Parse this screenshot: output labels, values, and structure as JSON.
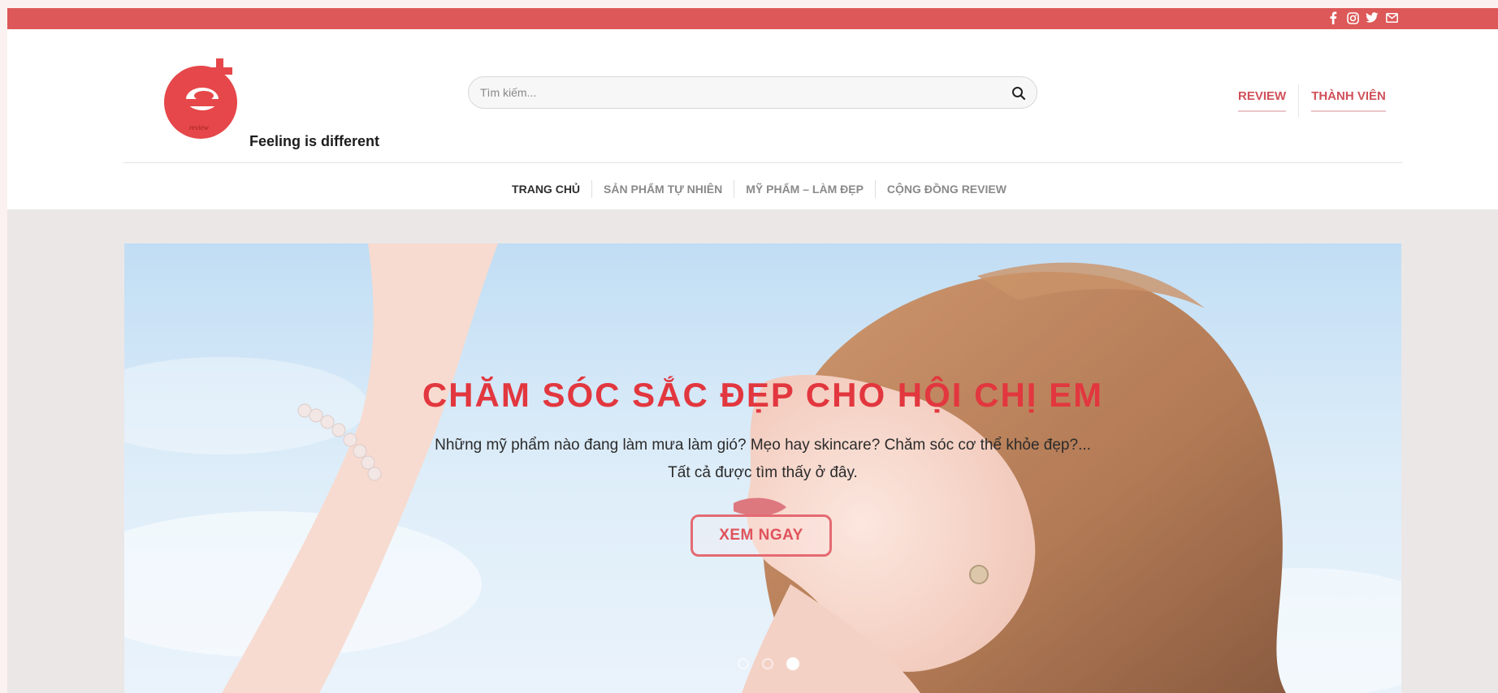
{
  "topbar": {
    "color": "#dd5858",
    "social": [
      "facebook-icon",
      "instagram-icon",
      "twitter-icon",
      "envelope-icon"
    ]
  },
  "header": {
    "logo_tagline": "Feeling is different",
    "logo_small_text": "review",
    "search": {
      "placeholder": "Tìm kiếm..."
    },
    "account_links": [
      "REVIEW",
      "THÀNH VIÊN"
    ]
  },
  "nav": {
    "items": [
      "TRANG CHỦ",
      "SẢN PHẨM TỰ NHIÊN",
      "MỸ PHẨM – LÀM ĐẸP",
      "CỘNG ĐỒNG REVIEW"
    ],
    "active": "TRANG CHỦ"
  },
  "hero": {
    "title": "CHĂM SÓC SẮC ĐẸP CHO HỘI CHỊ EM",
    "text_line1": "Những mỹ phẩm nào đang làm mưa làm gió? Mẹo hay skincare? Chăm sóc cơ thể khỏe đẹp?...",
    "text_line2": "Tất cả được tìm thấy ở đây.",
    "button": "XEM NGAY",
    "slide_count": 3,
    "active_slide": 3
  },
  "colors": {
    "accent": "#dd5858",
    "title_red": "#e2373f",
    "link_red": "#d0515a"
  }
}
